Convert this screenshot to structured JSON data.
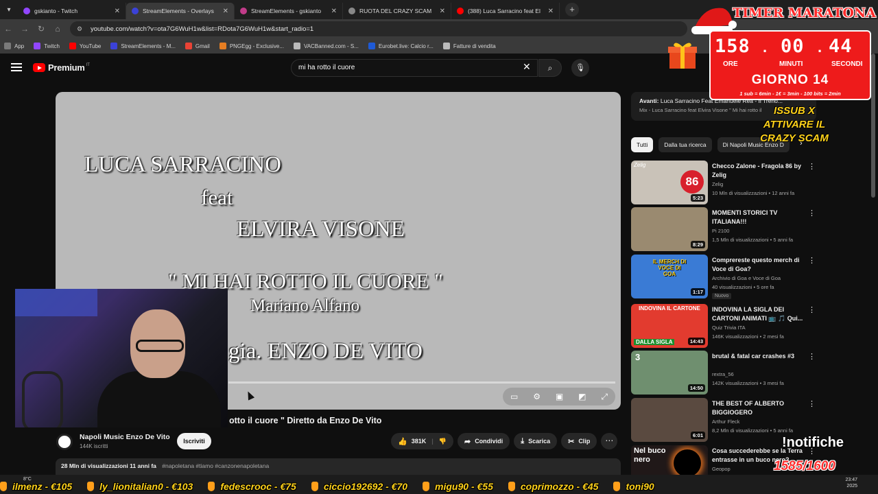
{
  "browser": {
    "tabs": [
      {
        "label": "gskianto - Twitch",
        "color": "#9146ff",
        "active": false
      },
      {
        "label": "StreamElements - Overlays",
        "color": "#3b42d8",
        "active": true
      },
      {
        "label": "StreamElements - gskianto",
        "color": "#c23c8a",
        "active": false
      },
      {
        "label": "RUOTA DEL CRAZY SCAM",
        "color": "#888888",
        "active": false
      },
      {
        "label": "(388) Luca Sarracino feat El",
        "color": "#ff0000",
        "active": false
      }
    ],
    "url": "youtube.com/watch?v=ota7G6WuH1w&list=RDota7G6WuH1w&start_radio=1",
    "bookmarks": [
      {
        "label": "App",
        "color": "#7a7a7a"
      },
      {
        "label": "Twitch",
        "color": "#9146ff"
      },
      {
        "label": "YouTube",
        "color": "#ff0000"
      },
      {
        "label": "StreamElements - M...",
        "color": "#3b42d8"
      },
      {
        "label": "Gmail",
        "color": "#ea4335"
      },
      {
        "label": "PNGEgg - Exclusive...",
        "color": "#e67e22"
      },
      {
        "label": "VACBanned.com - S...",
        "color": "#bbbbbb"
      },
      {
        "label": "Eurobet.live: Calcio r...",
        "color": "#1e5ad6"
      },
      {
        "label": "Fatture di vendita",
        "color": "#bbbbbb"
      }
    ]
  },
  "youtube": {
    "logo_text": "Premium",
    "country": "IT",
    "search_query": "mi ha rotto il cuore"
  },
  "video": {
    "overlay_lines": {
      "artist": "LUCA SARRACINO",
      "feat": "feat",
      "guest": "ELVIRA VISONE",
      "song": "\" MI HAI ROTTO IL CUORE \"",
      "author": "Mariano Alfano",
      "director": "gia. ENZO DE VITO"
    },
    "title": "otto il cuore \" Diretto da Enzo De Vito",
    "channel": "Napoli Music Enzo De Vito",
    "subscribers": "144K iscritti",
    "subscribe_label": "Iscriviti",
    "likes": "381K",
    "share_label": "Condividi",
    "download_label": "Scarica",
    "clip_label": "Clip",
    "views_date": "28 Mln di visualizzazioni  11 anni fa",
    "tags": "#napoletana #tiamo #canzonenapoletana"
  },
  "sidebar": {
    "upnext_prefix": "Avanti:",
    "upnext_title": "Luca Sarracino Feat Emanuele Rea - Il Treno...",
    "upnext_sub": "Mix - Luca Sarracino feat Elvira Visone \" Mi hai rotto il",
    "chips": [
      "Tutti",
      "Dalla tua ricerca",
      "Di Napoli Music Enzo D"
    ],
    "items": [
      {
        "title": "Checco Zalone - Fragola 86 by Zelig",
        "channel": "Zelig",
        "meta": "10 Mln di visualizzazioni • 12 anni fa",
        "duration": "5:23",
        "badge": "",
        "thumb": "#c9c2b8"
      },
      {
        "title": "MOMENTI STORICI TV ITALIANA!!!",
        "channel": "Pi 2100",
        "meta": "1,5 Mln di visualizzazioni • 5 anni fa",
        "duration": "8:29",
        "badge": "",
        "thumb": "#9a8a70"
      },
      {
        "title": "Comprereste questo merch di Voce di Goa?",
        "channel": "Archivio di Goa e Voce di Goa",
        "meta": "40 visualizzazioni • 5 ore fa",
        "duration": "1:17",
        "badge": "Nuovo",
        "thumb": "#3a7bd5"
      },
      {
        "title": "INDOVINA LA SIGLA DEI CARTONI ANIMATI 📺 🎵 Qui...",
        "channel": "Quiz Trivia ITA",
        "meta": "146K visualizzazioni • 2 mesi fa",
        "duration": "14:43",
        "badge": "",
        "thumb": "#e23b2f"
      },
      {
        "title": "brutal & fatal car crashes #3",
        "channel": "rextra_56",
        "meta": "142K visualizzazioni • 3 mesi fa",
        "duration": "14:50",
        "badge": "",
        "thumb": "#6f8f6f"
      },
      {
        "title": "THE BEST OF ALBERTO BIGGIOGERO",
        "channel": "Arthur Fleck",
        "meta": "8,2 Mln di visualizzazioni • 5 anni fa",
        "duration": "6:01",
        "badge": "",
        "thumb": "#5a4a40"
      },
      {
        "title": "Cosa succederebbe se la Terra entrasse in un buco nero?",
        "channel": "Geopop",
        "meta": "",
        "duration": "",
        "badge": "",
        "thumb": "#201818"
      }
    ],
    "thumb_text": {
      "zelig": "Zelig",
      "zelig_num": "86",
      "goa": "IL MERCH DI VOCE DI GOA",
      "cartoni_top": "INDOVINA IL CARTONE",
      "cartoni_bottom": "DALLA SIGLA",
      "crash_num": "3",
      "buco": "Nel buco nero"
    }
  },
  "overlay": {
    "timer_title": "TIMER MARATONA",
    "hours": "158",
    "minutes": "00",
    "seconds": "44",
    "hours_label": "ORE",
    "minutes_label": "MINUTI",
    "seconds_label": "SECONDI",
    "day": "GIORNO 14",
    "rules": "1 sub = 6min - 1€ = 3min - 100 bits = 2min",
    "scam_line1": "ISSUB X",
    "scam_line2": "ATTIVARE IL",
    "scam_line3": "CRAZY SCAM",
    "notif_label": "!notifiche",
    "goal": "1585/1600",
    "ticker": [
      "ilmenz - €105",
      "ly_lionitalian0 - €103",
      "fedescrooc - €75",
      "ciccio192692 - €70",
      "migu90 - €55",
      "coprimozzo - €45",
      "toni90"
    ]
  },
  "taskbar": {
    "weather": "8°C",
    "time": "23:47",
    "date": "2025"
  }
}
